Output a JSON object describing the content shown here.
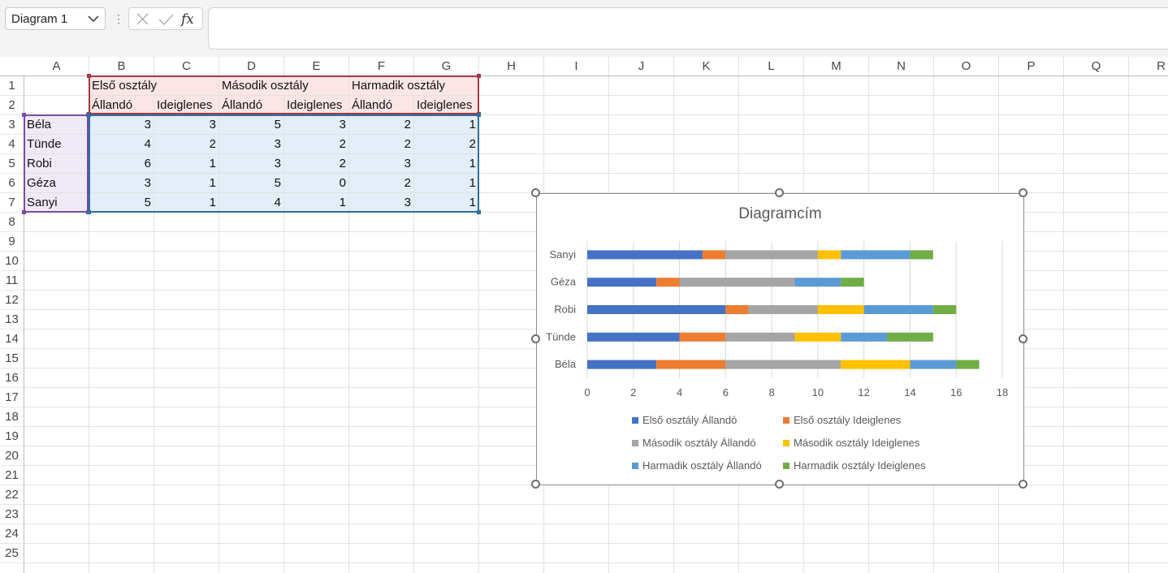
{
  "formula_bar": {
    "name_box": "Diagram 1",
    "cancel_icon": "x-icon",
    "enter_icon": "check-icon",
    "fx_icon": "fx-icon",
    "formula_value": ""
  },
  "columns": [
    "A",
    "B",
    "C",
    "D",
    "E",
    "F",
    "G",
    "H",
    "I",
    "J",
    "K",
    "L",
    "M",
    "N",
    "O",
    "P",
    "Q",
    "R"
  ],
  "rows": [
    "1",
    "2",
    "3",
    "4",
    "5",
    "6",
    "7",
    "8",
    "9",
    "10",
    "11",
    "12",
    "13",
    "14",
    "15",
    "16",
    "17",
    "18",
    "19",
    "20",
    "21",
    "22",
    "23",
    "24",
    "25"
  ],
  "sheet": {
    "header_row1": [
      "Első osztály",
      "Második osztály",
      "Harmadik osztály"
    ],
    "header_row2": [
      "Állandó",
      "Ideiglenes",
      "Állandó",
      "Ideiglenes",
      "Állandó",
      "Ideiglenes"
    ],
    "data": [
      {
        "name": "Béla",
        "values": [
          "3",
          "3",
          "5",
          "3",
          "2",
          "1"
        ]
      },
      {
        "name": "Tünde",
        "values": [
          "4",
          "2",
          "3",
          "2",
          "2",
          "2"
        ]
      },
      {
        "name": "Robi",
        "values": [
          "6",
          "1",
          "3",
          "2",
          "3",
          "1"
        ]
      },
      {
        "name": "Géza",
        "values": [
          "3",
          "1",
          "5",
          "0",
          "2",
          "1"
        ]
      },
      {
        "name": "Sanyi",
        "values": [
          "5",
          "1",
          "4",
          "1",
          "3",
          "1"
        ]
      }
    ]
  },
  "chart_data": {
    "type": "bar",
    "orientation": "horizontal",
    "stacked": true,
    "title": "Diagramcím",
    "categories": [
      "Béla",
      "Tünde",
      "Robi",
      "Géza",
      "Sanyi"
    ],
    "series": [
      {
        "name": "Első osztály Állandó",
        "color": "#4472C4",
        "values": [
          3,
          4,
          6,
          3,
          5
        ]
      },
      {
        "name": "Első osztály Ideiglenes",
        "color": "#ED7D31",
        "values": [
          3,
          2,
          1,
          1,
          1
        ]
      },
      {
        "name": "Második osztály Állandó",
        "color": "#A5A5A5",
        "values": [
          5,
          3,
          3,
          5,
          4
        ]
      },
      {
        "name": "Második osztály Ideiglenes",
        "color": "#FFC000",
        "values": [
          3,
          2,
          2,
          0,
          1
        ]
      },
      {
        "name": "Harmadik osztály Állandó",
        "color": "#5B9BD5",
        "values": [
          2,
          2,
          3,
          2,
          3
        ]
      },
      {
        "name": "Harmadik osztály Ideiglenes",
        "color": "#70AD47",
        "values": [
          1,
          2,
          1,
          1,
          1
        ]
      }
    ],
    "xlim": [
      0,
      18
    ],
    "x_ticks": [
      "0",
      "2",
      "4",
      "6",
      "8",
      "10",
      "12",
      "14",
      "16",
      "18"
    ],
    "grid": true,
    "legend_position": "bottom"
  },
  "colors": {
    "header_fill": "#fbe5e5",
    "data_fill": "#e3eef8",
    "name_fill": "#efeaf6",
    "header_border": "#a33a45",
    "data_border": "#2e6e9e",
    "name_border": "#7a4ca0"
  }
}
